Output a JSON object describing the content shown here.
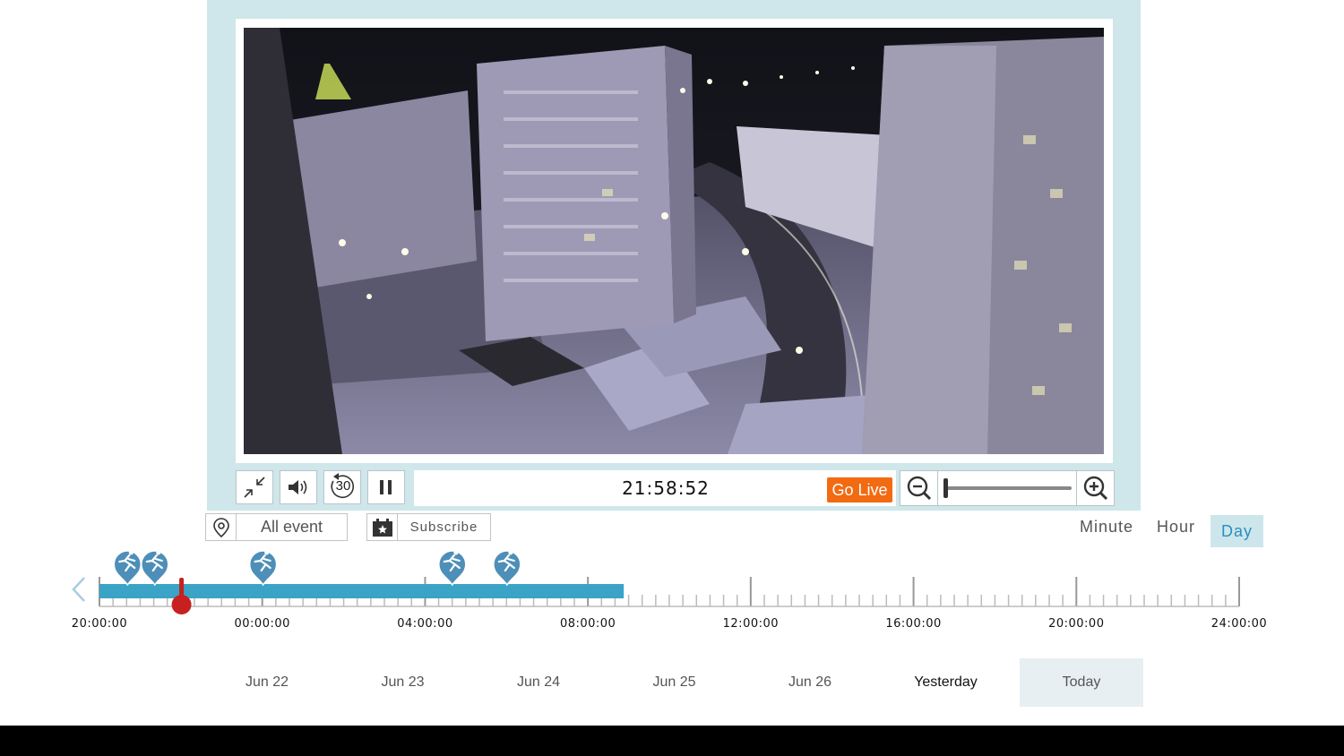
{
  "player": {
    "time": "21:58:52",
    "go_live": "Go Live",
    "replay_label": "30"
  },
  "filters": {
    "event_filter": "All event",
    "subscribe": "Subscribe"
  },
  "scale": {
    "minute": "Minute",
    "hour": "Hour",
    "day": "Day",
    "active": "Day"
  },
  "timeline": {
    "tick_labels": [
      "20:00:00",
      "00:00:00",
      "04:00:00",
      "08:00:00",
      "12:00:00",
      "16:00:00",
      "20:00:00",
      "24:00:00"
    ],
    "recorded_until_fraction": 0.46,
    "cursor_fraction": 0.072,
    "event_fractions": [
      0.012,
      0.036,
      0.131,
      0.297,
      0.345
    ],
    "event_icon": "running-person-icon",
    "colors": {
      "recorded": "#3aa3c6",
      "cursor": "#c82020",
      "event": "#4d8fb8"
    }
  },
  "days": [
    "Jun 22",
    "Jun 23",
    "Jun 24",
    "Jun 25",
    "Jun 26",
    "Yesterday",
    "Today"
  ],
  "current_day": "Today",
  "colors": {
    "frame": "#cfe6ea",
    "accent": "#2a8fc0",
    "go_live": "#f26a12"
  }
}
